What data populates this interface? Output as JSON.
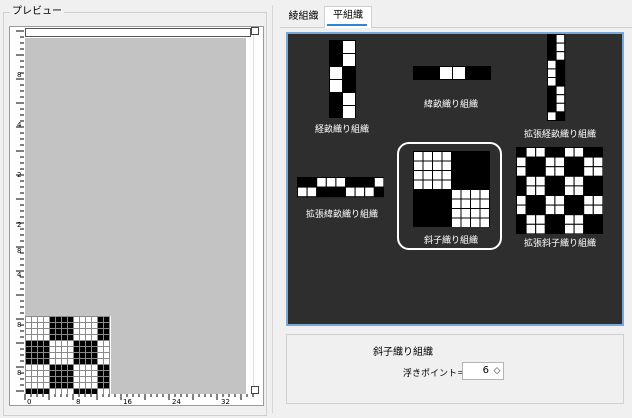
{
  "preview": {
    "title": "プレビュー",
    "vruler_labels": [
      "8",
      "4",
      "2",
      "2",
      "8",
      "4",
      "8",
      "8"
    ],
    "hruler_labels": [
      "0",
      "8",
      "16",
      "24",
      "32"
    ]
  },
  "tabs": [
    {
      "label": "綾組織",
      "selected": false
    },
    {
      "label": "平組織",
      "selected": true
    }
  ],
  "weaves": [
    {
      "label": "経畝織り組織",
      "selected": false
    },
    {
      "label": "緯畝織り組織",
      "selected": false
    },
    {
      "label": "拡張経畝織り組織",
      "selected": false
    },
    {
      "label": "拡張緯畝織り組織",
      "selected": false
    },
    {
      "label": "斜子織り組織",
      "selected": true
    },
    {
      "label": "拡張斜子織り組織",
      "selected": false
    }
  ],
  "details": {
    "name": "斜子織り組織",
    "float_label": "浮きポイント＝",
    "float_value": "6"
  },
  "colors": {
    "panel_bg": "#2e2e2e",
    "panel_border": "#7aa7d6",
    "tab_accent": "#2e84d8"
  }
}
